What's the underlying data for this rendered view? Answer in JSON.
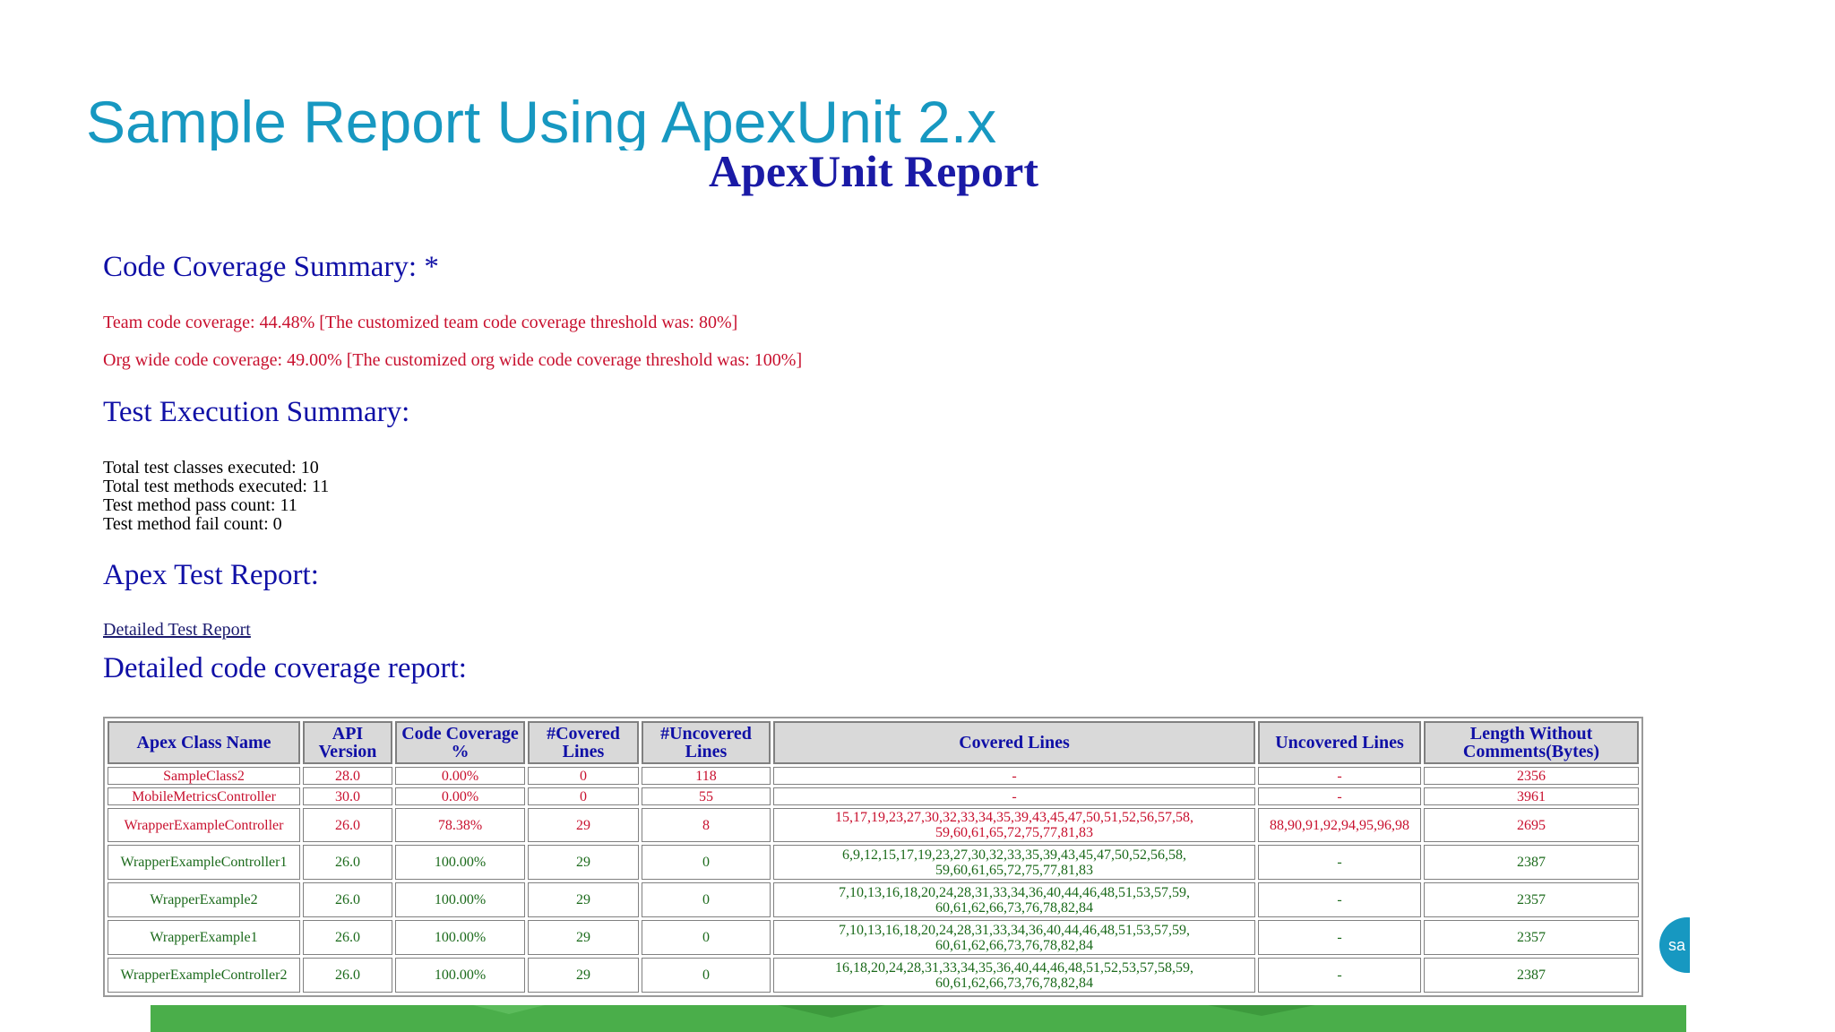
{
  "slide_title": "Sample Report Using ApexUnit 2.x",
  "report_title": "ApexUnit Report",
  "code_coverage_summary": {
    "heading": "Code Coverage Summary: *",
    "team_line": "Team code coverage: 44.48% [The customized team code coverage threshold was: 80%]",
    "org_line": "Org wide code coverage: 49.00% [The customized org wide code coverage threshold was: 100%]"
  },
  "test_execution_summary": {
    "heading": "Test Execution Summary:",
    "lines": [
      "Total test classes executed: 10",
      "Total test methods executed: 11",
      "Test method pass count: 11",
      "Test method fail count: 0"
    ]
  },
  "apex_test_report": {
    "heading": "Apex Test Report:",
    "link_label": "Detailed Test Report"
  },
  "detailed_coverage": {
    "heading": "Detailed code coverage report:",
    "columns": [
      "Apex Class Name",
      "API Version",
      "Code Coverage %",
      "#Covered Lines",
      "#Uncovered Lines",
      "Covered Lines",
      "Uncovered Lines",
      "Length Without Comments(Bytes)"
    ],
    "rows": [
      {
        "status": "fail",
        "cells": [
          "SampleClass2",
          "28.0",
          "0.00%",
          "0",
          "118",
          "-",
          "-",
          "2356"
        ]
      },
      {
        "status": "fail",
        "cells": [
          "MobileMetricsController",
          "30.0",
          "0.00%",
          "0",
          "55",
          "-",
          "-",
          "3961"
        ]
      },
      {
        "status": "fail",
        "cells": [
          "WrapperExampleController",
          "26.0",
          "78.38%",
          "29",
          "8",
          "15,17,19,23,27,30,32,33,34,35, 39,43,45,47,50,51,52,56,57,58, 59,60,61,65,72,75,77,81,83",
          "88,90,91,92,94,95,96,98",
          "2695"
        ]
      },
      {
        "status": "pass",
        "cells": [
          "WrapperExampleController1",
          "26.0",
          "100.00%",
          "29",
          "0",
          "6,9,12,15,17,19,23,27,30,32, 33,35,39,43,45,47,50,52,56,58, 59,60,61,65,72,75,77,81,83",
          "-",
          "2387"
        ]
      },
      {
        "status": "pass",
        "cells": [
          "WrapperExample2",
          "26.0",
          "100.00%",
          "29",
          "0",
          "7,10,13,16,18,20,24,28,31,33, 34,36,40,44,46,48,51,53,57,59, 60,61,62,66,73,76,78,82,84",
          "-",
          "2357"
        ]
      },
      {
        "status": "pass",
        "cells": [
          "WrapperExample1",
          "26.0",
          "100.00%",
          "29",
          "0",
          "7,10,13,16,18,20,24,28,31,33, 34,36,40,44,46,48,51,53,57,59, 60,61,62,66,73,76,78,82,84",
          "-",
          "2357"
        ]
      },
      {
        "status": "pass",
        "cells": [
          "WrapperExampleController2",
          "26.0",
          "100.00%",
          "29",
          "0",
          "16,18,20,24,28,31,33,34,35,36, 40,44,46,48,51,52,53,57,58,59, 60,61,62,66,73,76,78,82,84",
          "-",
          "2387"
        ]
      }
    ]
  },
  "logo_text": "sa",
  "colors": {
    "slide_title": "#1798c1",
    "report_title": "#1a1aa6",
    "heading": "#1010a6",
    "fail": "#c8102e",
    "pass": "#1b6a1b",
    "footer": "#4aae4a"
  }
}
